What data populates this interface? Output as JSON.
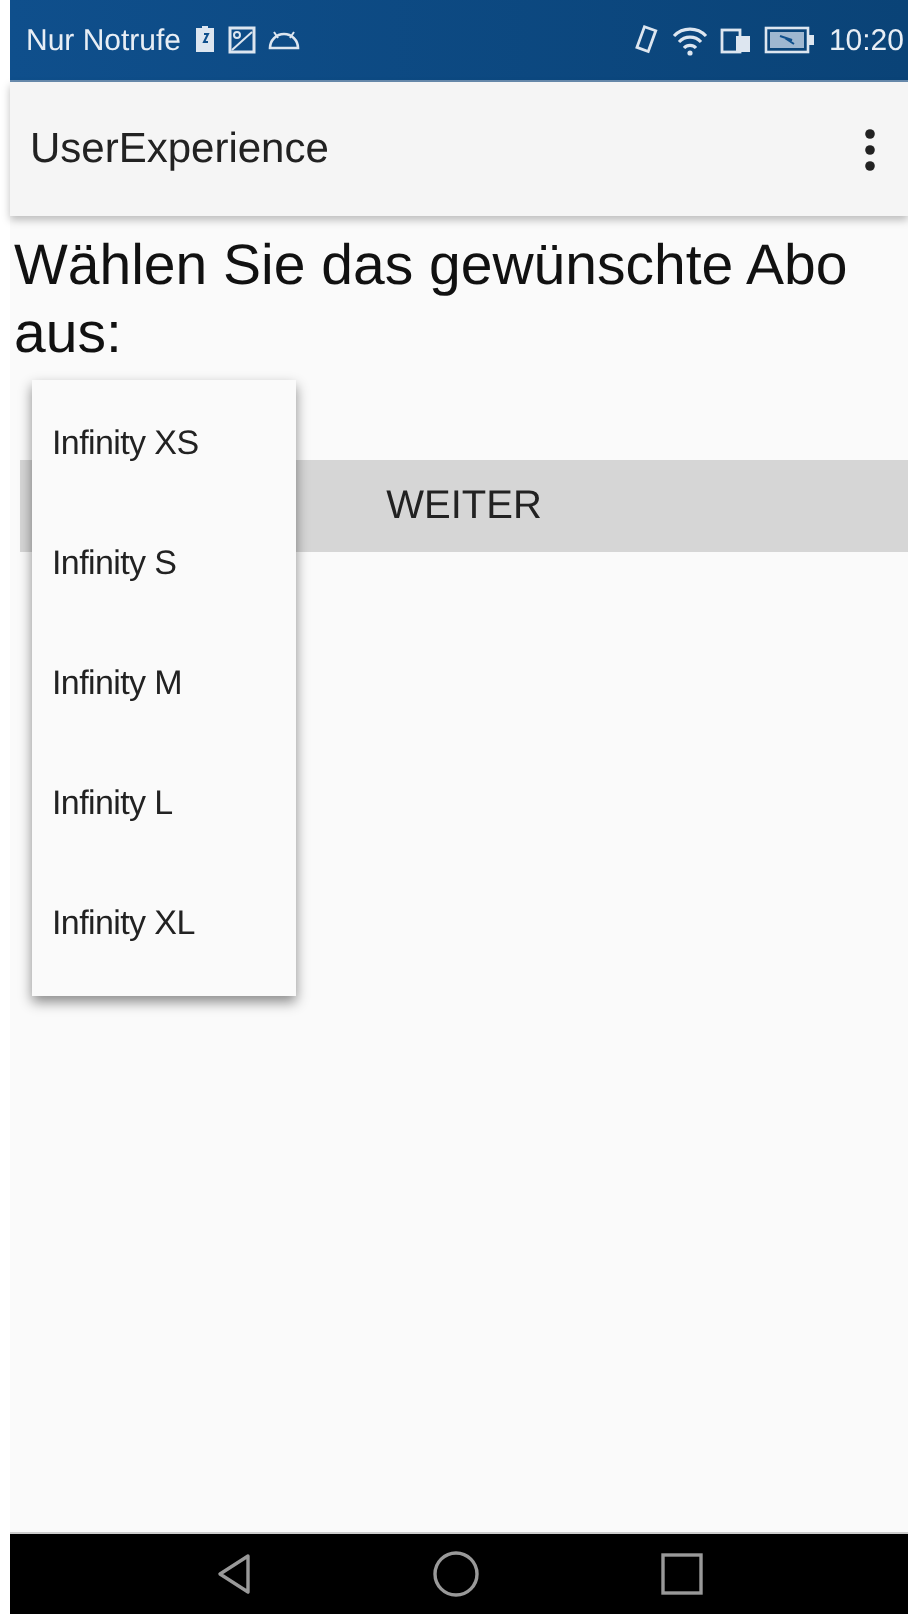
{
  "status_bar": {
    "carrier": "Nur Notrufe",
    "time": "10:20"
  },
  "app_bar": {
    "title": "UserExperience"
  },
  "prompt": "Wählen Sie das gewünschte Abo aus:",
  "button": "WEITER",
  "dropdown": {
    "items": [
      {
        "label": "Infinity XS"
      },
      {
        "label": "Infinity S"
      },
      {
        "label": "Infinity M"
      },
      {
        "label": "Infinity L"
      },
      {
        "label": "Infinity XL"
      }
    ]
  }
}
